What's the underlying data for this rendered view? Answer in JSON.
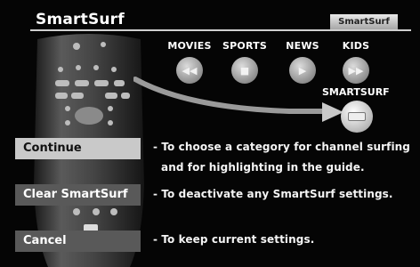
{
  "header": {
    "title": "SmartSurf",
    "logo_text": "SmartSurf"
  },
  "categories": [
    {
      "label": "MOVIES",
      "icon": "rewind-icon",
      "glyph": "◀◀"
    },
    {
      "label": "SPORTS",
      "icon": "stop-icon",
      "glyph": "■"
    },
    {
      "label": "NEWS",
      "icon": "play-icon",
      "glyph": "▶"
    },
    {
      "label": "KIDS",
      "icon": "fast-forward-icon",
      "glyph": "▶▶"
    }
  ],
  "smartsurf": {
    "label": "SMARTSURF",
    "icon": "smartsurf-icon"
  },
  "options": [
    {
      "label": "Continue",
      "description": "- To choose a category for channel surfing",
      "description2": "and for highlighting in the guide."
    },
    {
      "label": "Clear SmartSurf",
      "description": "- To deactivate any SmartSurf settings."
    },
    {
      "label": "Cancel",
      "description": "- To keep current settings."
    }
  ],
  "colors": {
    "background": "#050505",
    "selected_button": "#c9c9c9",
    "button": "#595959",
    "text": "#ffffff"
  }
}
